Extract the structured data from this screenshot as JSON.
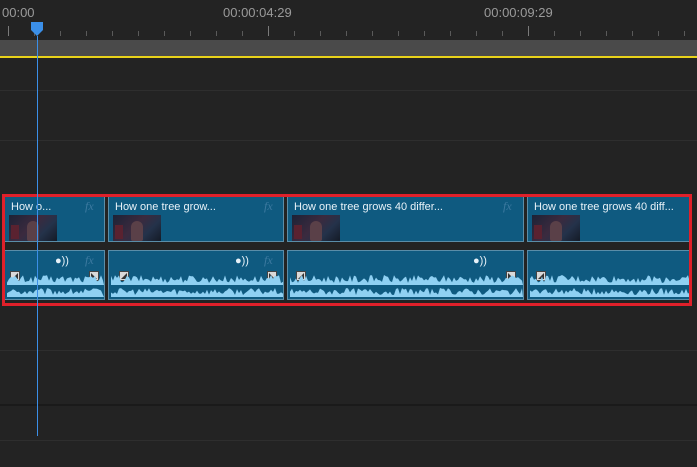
{
  "ruler": {
    "timecodes": [
      "00:00",
      "00:00:04:29",
      "00:00:09:29"
    ]
  },
  "video_clips": [
    {
      "title": "How o...",
      "fx": "fx"
    },
    {
      "title": "How one tree grow...",
      "fx": "fx"
    },
    {
      "title": "How one tree grows 40 differ...",
      "fx": "fx"
    },
    {
      "title": "How one tree grows 40 diff...",
      "fx": "fx"
    }
  ],
  "audio_clips": [
    {
      "fx": "fx",
      "voice_icon": "voice-changer-icon"
    },
    {
      "fx": "fx",
      "voice_icon": "voice-changer-icon"
    },
    {
      "fx": "fx",
      "voice_icon": "voice-changer-icon"
    },
    {
      "fx": "fx",
      "voice_icon": "voice-changer-icon"
    }
  ],
  "colors": {
    "clip": "#0f5a80",
    "waveform": "#8fd0f2",
    "selection": "#e0202a",
    "playhead": "#3b8fe8",
    "workarea": "#e8d21a"
  }
}
